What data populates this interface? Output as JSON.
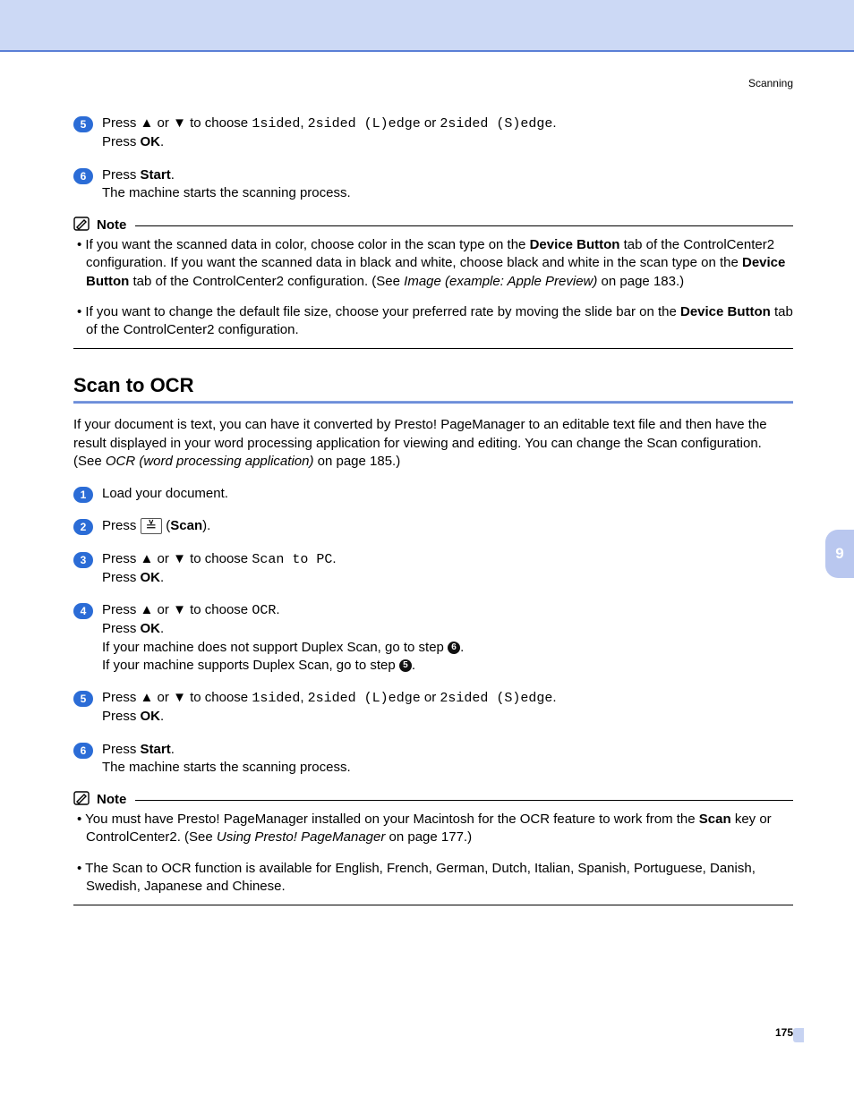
{
  "header": {
    "section": "Scanning"
  },
  "sidetab": {
    "chapter": "9"
  },
  "pagenum": "175",
  "glyph": {
    "up": "▲",
    "down": "▼"
  },
  "top_steps": [
    {
      "num": "5",
      "t1": "Press ",
      "t2": " or ",
      "t3": " to choose ",
      "c1": "1sided",
      "t4": ", ",
      "c2": "2sided (L)edge",
      "t5": " or ",
      "c3": "2sided (S)edge",
      "t6": ".",
      "line2a": "Press ",
      "line2b": "OK",
      "line2c": "."
    },
    {
      "num": "6",
      "t1": "Press ",
      "b1": "Start",
      "t2": ".",
      "line2": "The machine starts the scanning process."
    }
  ],
  "note1": {
    "label": "Note",
    "items": [
      {
        "seg": [
          {
            "t": "If you want the scanned data in color, choose color in the scan type on the "
          },
          {
            "b": "Device Button"
          },
          {
            "t": " tab of the ControlCenter2 configuration. If you want the scanned data in black and white, choose black and white in the scan type on the "
          },
          {
            "b": "Device Button"
          },
          {
            "t": " tab of the ControlCenter2 configuration. (See "
          },
          {
            "i": "Image (example: Apple Preview)"
          },
          {
            "t": " on page 183.)"
          }
        ]
      },
      {
        "seg": [
          {
            "t": "If you want to change the default file size, choose your preferred rate by moving the slide bar on the "
          },
          {
            "b": "Device Button"
          },
          {
            "t": " tab of the ControlCenter2 configuration."
          }
        ]
      }
    ]
  },
  "section": {
    "title": "Scan to OCR",
    "intro": [
      {
        "t": "If your document is text, you can have it converted by Presto! PageManager to an editable text file and then have the result displayed in your word processing application for viewing and editing. You can change the Scan configuration. (See "
      },
      {
        "i": "OCR (word processing application)"
      },
      {
        "t": " on page 185.)"
      }
    ]
  },
  "ocr_steps": [
    {
      "num": "1",
      "plain": "Load your document."
    },
    {
      "num": "2",
      "t1": "Press ",
      "scan_icon": "≚",
      "t2": " (",
      "b1": "Scan",
      "t3": ")."
    },
    {
      "num": "3",
      "t1": "Press ",
      "t2": " or ",
      "t3": " to choose ",
      "c1": "Scan to PC",
      "t4": ".",
      "line2a": "Press ",
      "line2b": "OK",
      "line2c": "."
    },
    {
      "num": "4",
      "t1": "Press ",
      "t2": " or ",
      "t3": " to choose ",
      "c1": "OCR",
      "t4": ".",
      "line2a": "Press ",
      "line2b": "OK",
      "line2c": ".",
      "line3a": "If your machine does not support Duplex Scan, go to step ",
      "dot3": "6",
      "line3b": ".",
      "line4a": "If your machine supports Duplex Scan, go to step ",
      "dot4": "5",
      "line4b": "."
    },
    {
      "num": "5",
      "t1": "Press ",
      "t2": " or ",
      "t3": " to choose ",
      "c1": "1sided",
      "t4": ", ",
      "c2": "2sided (L)edge",
      "t5": " or ",
      "c3": "2sided (S)edge",
      "t6": ".",
      "line2a": "Press ",
      "line2b": "OK",
      "line2c": "."
    },
    {
      "num": "6",
      "t1": "Press ",
      "b1": "Start",
      "t2": ".",
      "line2": "The machine starts the scanning process."
    }
  ],
  "note2": {
    "label": "Note",
    "items": [
      {
        "seg": [
          {
            "t": "You must have Presto! PageManager installed on your Macintosh for the OCR feature to work from the "
          },
          {
            "b": "Scan"
          },
          {
            "t": " key or ControlCenter2. (See "
          },
          {
            "i": "Using Presto! PageManager"
          },
          {
            "t": " on page 177.)"
          }
        ]
      },
      {
        "seg": [
          {
            "t": "The Scan to OCR function is available for English, French, German, Dutch, Italian, Spanish, Portuguese, Danish, Swedish, Japanese and Chinese."
          }
        ]
      }
    ]
  }
}
